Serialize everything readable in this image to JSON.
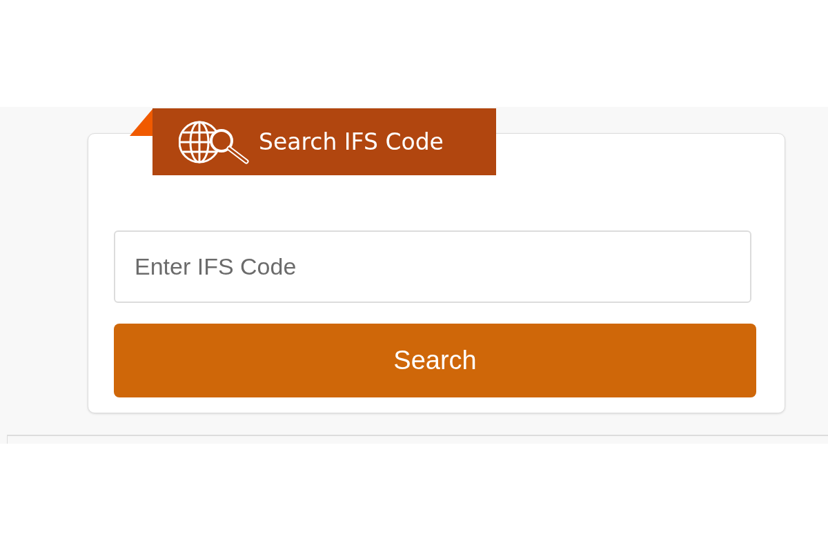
{
  "card": {
    "title": "Search IFS Code"
  },
  "search_field": {
    "placeholder": "Enter IFS Code"
  },
  "search_button": {
    "label": "Search"
  }
}
